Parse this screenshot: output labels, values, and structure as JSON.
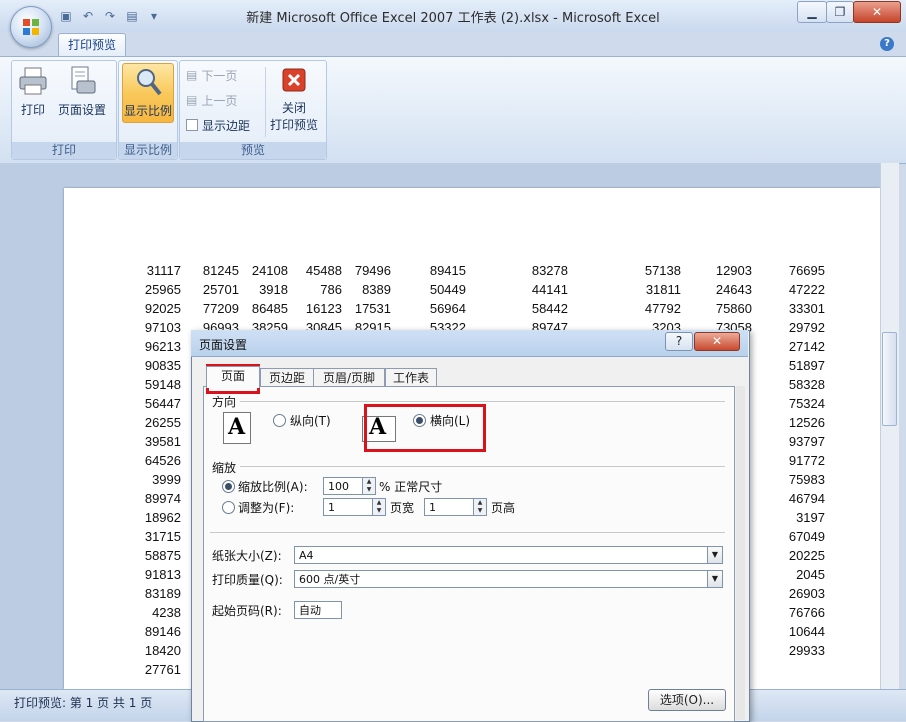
{
  "window": {
    "title": "新建 Microsoft Office Excel 2007 工作表 (2).xlsx - Microsoft Excel",
    "minimize": "▁",
    "maximize": "❐",
    "close": "✕"
  },
  "ribbon": {
    "tab": "打印预览",
    "groups": {
      "print": {
        "label": "打印",
        "print_btn": "打印",
        "page_setup_btn": "页面设置"
      },
      "zoom": {
        "label": "显示比例",
        "zoom_btn": "显示比例"
      },
      "preview": {
        "label": "预览",
        "next_page": "下一页",
        "prev_page": "上一页",
        "show_margins": "显示边距",
        "close_preview_line1": "关闭",
        "close_preview_line2": "打印预览"
      }
    }
  },
  "sheet": {
    "rows": [
      [
        "31117",
        "81245",
        "24108",
        "45488",
        "79496",
        "89415",
        "83278",
        "57138",
        "12903",
        "76695"
      ],
      [
        "25965",
        "25701",
        "3918",
        "786",
        "8389",
        "50449",
        "44141",
        "31811",
        "24643",
        "47222"
      ],
      [
        "92025",
        "77209",
        "86485",
        "16123",
        "17531",
        "56964",
        "58442",
        "47792",
        "75860",
        "33301"
      ],
      [
        "97103",
        "96993",
        "38259",
        "30845",
        "82915",
        "53322",
        "89747",
        "3203",
        "73058",
        "29792"
      ],
      [
        "96213",
        "",
        "",
        "",
        "",
        "",
        "",
        "",
        "",
        "27142"
      ],
      [
        "90835",
        "",
        "",
        "",
        "",
        "",
        "",
        "",
        "",
        "51897"
      ],
      [
        "59148",
        "",
        "",
        "",
        "",
        "",
        "",
        "",
        "",
        "58328"
      ],
      [
        "56447",
        "",
        "",
        "",
        "",
        "",
        "",
        "",
        "",
        "75324"
      ],
      [
        "26255",
        "",
        "",
        "",
        "",
        "",
        "",
        "",
        "",
        "12526"
      ],
      [
        "39581",
        "",
        "",
        "",
        "",
        "",
        "",
        "",
        "",
        "93797"
      ],
      [
        "64526",
        "",
        "",
        "",
        "",
        "",
        "",
        "",
        "",
        "91772"
      ],
      [
        "3999",
        "",
        "",
        "",
        "",
        "",
        "",
        "",
        "",
        "75983"
      ],
      [
        "89974",
        "",
        "",
        "",
        "",
        "",
        "",
        "",
        "",
        "46794"
      ],
      [
        "18962",
        "",
        "",
        "",
        "",
        "",
        "",
        "",
        "",
        "3197"
      ],
      [
        "31715",
        "",
        "",
        "",
        "",
        "",
        "",
        "",
        "",
        "67049"
      ],
      [
        "58875",
        "",
        "",
        "",
        "",
        "",
        "",
        "",
        "",
        "20225"
      ],
      [
        "91813",
        "",
        "",
        "",
        "",
        "",
        "",
        "",
        "",
        "2045"
      ],
      [
        "83189",
        "",
        "",
        "",
        "",
        "",
        "",
        "",
        "",
        "26903"
      ],
      [
        "4238",
        "",
        "",
        "",
        "",
        "",
        "",
        "",
        "",
        "76766"
      ],
      [
        "89146",
        "",
        "",
        "",
        "",
        "",
        "",
        "",
        "",
        "10644"
      ],
      [
        "18420",
        "",
        "",
        "",
        "",
        "",
        "",
        "",
        "",
        "29933"
      ],
      [
        "27761",
        "",
        "",
        "",
        "",
        "",
        "",
        "",
        "",
        ""
      ]
    ]
  },
  "status": {
    "text": "打印预览: 第 1 页 共 1 页"
  },
  "dialog": {
    "title": "页面设置",
    "help": "?",
    "close": "✕",
    "tabs": [
      "页面",
      "页边距",
      "页眉/页脚",
      "工作表"
    ],
    "orientation": {
      "section": "方向",
      "portrait": "纵向(T)",
      "landscape": "横向(L)",
      "glyph": "A"
    },
    "scaling": {
      "section": "缩放",
      "adjust_to": "缩放比例(A):",
      "adjust_value": "100",
      "normal_size": "% 正常尺寸",
      "fit_to": "调整为(F):",
      "pages_wide_value": "1",
      "pages_wide": "页宽",
      "pages_tall_value": "1",
      "pages_tall": "页高"
    },
    "paper_size_label": "纸张大小(Z):",
    "paper_size_value": "A4",
    "print_quality_label": "打印质量(Q):",
    "print_quality_value": "600 点/英寸",
    "first_page_label": "起始页码(R):",
    "first_page_value": "自动",
    "options_btn": "选项(O)..."
  }
}
